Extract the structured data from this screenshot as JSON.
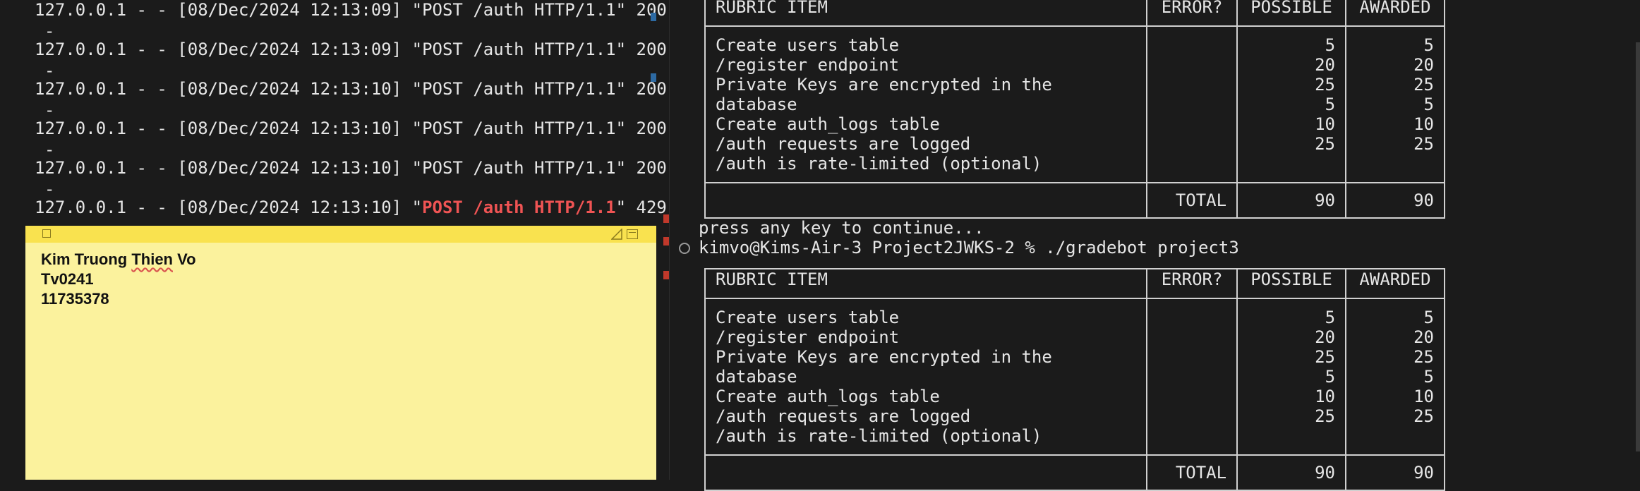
{
  "log": {
    "lines": [
      {
        "prefix": "127.0.0.1 - - [08/Dec/2024 12:13:09] \"",
        "request": "POST /auth HTTP/1.1",
        "suffix": "\" 200"
      },
      {
        "prefix": "127.0.0.1 - - [08/Dec/2024 12:13:09] \"",
        "request": "POST /auth HTTP/1.1",
        "suffix": "\" 200"
      },
      {
        "prefix": "127.0.0.1 - - [08/Dec/2024 12:13:10] \"",
        "request": "POST /auth HTTP/1.1",
        "suffix": "\" 200"
      },
      {
        "prefix": "127.0.0.1 - - [08/Dec/2024 12:13:10] \"",
        "request": "POST /auth HTTP/1.1",
        "suffix": "\" 200"
      },
      {
        "prefix": "127.0.0.1 - - [08/Dec/2024 12:13:10] \"",
        "request": "POST /auth HTTP/1.1",
        "suffix": "\" 200"
      },
      {
        "prefix": "127.0.0.1 - - [08/Dec/2024 12:13:10] \"",
        "request": "POST /auth HTTP/1.1",
        "suffix": "\" 429"
      }
    ],
    "dash": "-"
  },
  "sticky": {
    "line1_a": "Kim Truong ",
    "line1_b": "Thien",
    "line1_c": " Vo",
    "line2": "Tv0241",
    "line3": "11735378",
    "color": "#fbf29d"
  },
  "terminal": {
    "continue": "press any key to continue...",
    "prompt": "kimvo@Kims-Air-3 Project2JWKS-2 % ./gradebot project3"
  },
  "rubric": {
    "headers": [
      "RUBRIC ITEM",
      "ERROR?",
      "POSSIBLE",
      "AWARDED"
    ],
    "items": [
      {
        "name": "Create users table",
        "possible": "5",
        "awarded": "5"
      },
      {
        "name": "/register endpoint",
        "possible": "20",
        "awarded": "20"
      },
      {
        "name": "Private Keys are encrypted in the database",
        "possible": "25",
        "awarded": "25"
      },
      {
        "name": "Create auth_logs table",
        "possible": "5",
        "awarded": "5"
      },
      {
        "name": "/auth requests are logged",
        "possible": "10",
        "awarded": "10"
      },
      {
        "name": "/auth is rate-limited (optional)",
        "possible": "25",
        "awarded": "25"
      }
    ],
    "total_label": "TOTAL",
    "total_possible": "90",
    "total_awarded": "90"
  },
  "colors": {
    "error_highlight": "#f05454",
    "scroll_marker_blue": "#2d6aa3",
    "scroll_marker_red": "#c0392b"
  }
}
